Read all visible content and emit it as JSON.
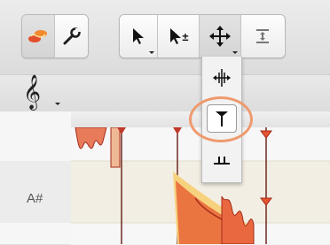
{
  "toolbar": {
    "left_group": [
      {
        "name": "notes-tool-icon",
        "active": true
      },
      {
        "name": "wrench-icon",
        "active": false
      }
    ],
    "right_group": [
      {
        "name": "pointer-icon",
        "has_menu": true
      },
      {
        "name": "pointer-plus-minus-icon",
        "label": "±"
      },
      {
        "name": "move-tool-icon",
        "has_menu": true
      },
      {
        "name": "vertical-align-icon"
      }
    ]
  },
  "clef": {
    "name": "treble-clef-icon",
    "glyph": "𝄞"
  },
  "dropdown": {
    "items": [
      {
        "name": "time-stretch-icon"
      },
      {
        "name": "sustain-tool-icon",
        "highlighted": true
      },
      {
        "name": "separation-icon"
      }
    ]
  },
  "editor": {
    "pitch_label": "A#"
  },
  "colors": {
    "accent_orange": "#ee9a6e",
    "waveform_red": "#c0392b",
    "waveform_light": "#f6d27e"
  }
}
